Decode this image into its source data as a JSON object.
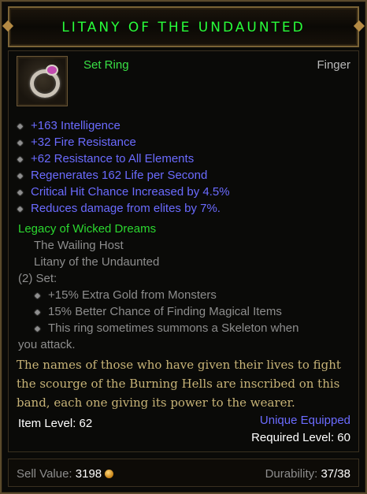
{
  "item": {
    "name": "LITANY OF THE UNDAUNTED",
    "type": "Set Ring",
    "slot": "Finger",
    "icon": "ring-icon"
  },
  "primary_stats": [
    "+163 Intelligence",
    "+32 Fire Resistance",
    "+62 Resistance to All Elements",
    "Regenerates 162 Life per Second",
    "Critical Hit Chance Increased by 4.5%",
    "Reduces damage from elites by 7%."
  ],
  "set": {
    "name": "Legacy of Wicked Dreams",
    "pieces": [
      "The Wailing Host",
      "Litany of the Undaunted"
    ],
    "bonus_header": "(2) Set:",
    "bonuses": [
      "+15% Extra Gold from Monsters",
      "15% Better Chance of Finding Magical Items",
      "This ring sometimes summons a Skeleton when"
    ],
    "bonus_wrap": "you attack."
  },
  "flavor_lines": [
    "The names of those who have given their lives to fight",
    "the scourge of the Burning Hells are inscribed on this",
    "band, each one giving its power to the wearer."
  ],
  "item_level": "Item Level: 62",
  "unique_equipped": "Unique Equipped",
  "required_level": "Required Level: 60",
  "footer": {
    "sell_label": "Sell Value:",
    "sell_value": "3198",
    "durability_label": "Durability:",
    "durability_value": "37/38"
  },
  "colors": {
    "title_green": "#28ff3a",
    "magic_blue": "#6b6bff",
    "set_green": "#2bd82f",
    "flavor_gold": "#c7b377",
    "border_bronze": "#7a6336"
  }
}
